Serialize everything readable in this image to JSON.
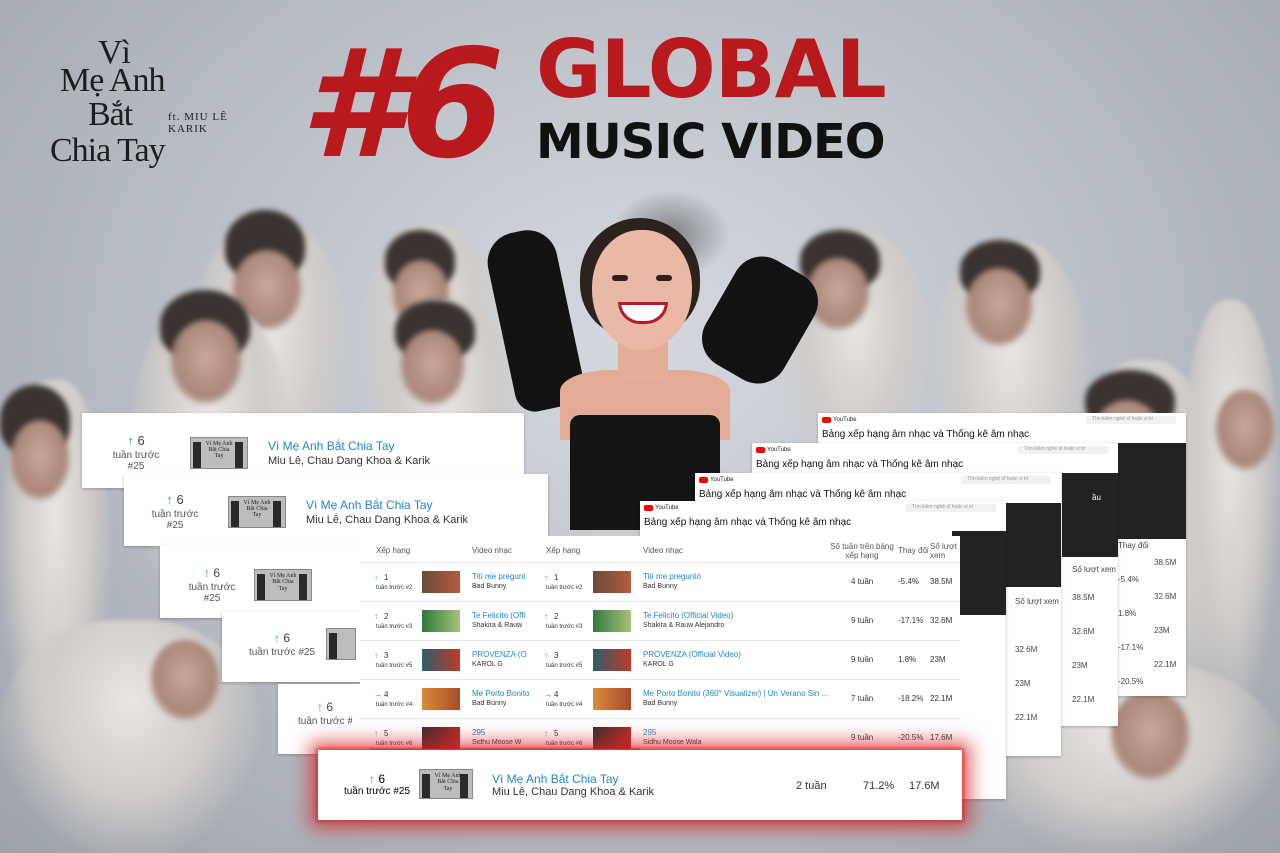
{
  "logo": {
    "line1": "Vì",
    "line2": "Mẹ Anh",
    "line3": "Bắt",
    "line4": "Chia Tay",
    "feat": "ft. MIU LÊ\nKARIK"
  },
  "headline": {
    "number": "#6",
    "line1": "GLOBAL",
    "line2": "MUSIC VIDEO"
  },
  "colors": {
    "accent_red": "#b8191c",
    "link_blue": "#1e88c7",
    "up_arrow": "#26a69a"
  },
  "entry": {
    "rank": "6",
    "prev_week": "tuần trước #25",
    "title": "Vì Mẹ Anh Bắt Chia Tay",
    "artist": "Miu Lê, Chau Dang Khoa & Karik",
    "weeks": "2 tuần",
    "change": "71.2%",
    "views": "17.6M",
    "thumb_text": "Vì Mẹ Anh Bắt Chia Tay"
  },
  "chart_page": {
    "app": "YouTube",
    "title": "Bảng xếp hạng âm nhạc và Thống kê âm nhạc",
    "search_placeholder": "Tìm kiếm nghệ sĩ hoặc vi trí",
    "headers": {
      "rank": "Xếp hạng",
      "video": "Video nhạc",
      "weeks": "Số tuần trên bảng xếp hạng",
      "change": "Thay đổi",
      "views": "Số lượt xem"
    },
    "rows": [
      {
        "rank": "1",
        "icon": "up-arrow-icon",
        "prev": "tuần trước #2",
        "title": "Tití me preguntó",
        "title_short": "Tití me pregunt",
        "artist": "Bad Bunny",
        "weeks": "4 tuần",
        "change": "-5.4%",
        "views": "38.5M"
      },
      {
        "rank": "2",
        "icon": "up-arrow-icon",
        "prev": "tuần trước #3",
        "title": "Te Felicito (Official Video)",
        "title_short": "Te Felicito (Offi",
        "artist": "Shakira & Rauw Alejandro",
        "artist_short": "Shakira & Rauw",
        "weeks": "9 tuần",
        "change": "-17.1%",
        "views": "32.6M"
      },
      {
        "rank": "3",
        "icon": "up-arrow-icon",
        "prev": "tuần trước #5",
        "title": "PROVENZA (Official Video)",
        "title_short": "PROVENZA (O",
        "artist": "KAROL G",
        "weeks": "9 tuần",
        "change": "1.8%",
        "views": "23M"
      },
      {
        "rank": "4",
        "icon": "right-arrow-icon",
        "prev": "tuần trước #4",
        "title": "Me Porto Bonito (360° Visualizer) | Un Verano Sin ...",
        "title_short": "Me Porto Bonito",
        "artist": "Bad Bunny",
        "weeks": "7 tuần",
        "change": "-18.2%",
        "views": "22.1M"
      },
      {
        "rank": "5",
        "icon": "up-arrow-icon",
        "prev": "tuần trước #6",
        "title": "295",
        "title_short": "295",
        "artist": "Sidhu Moose Wala",
        "artist_short": "Sidhu Moose W",
        "weeks": "9 tuần",
        "change": "-20.5%",
        "views": "17.6M"
      }
    ],
    "side_fragments": {
      "weeks_label": "Số lượt xem",
      "change_label": "Thay đổi",
      "partial": "ầu"
    }
  }
}
